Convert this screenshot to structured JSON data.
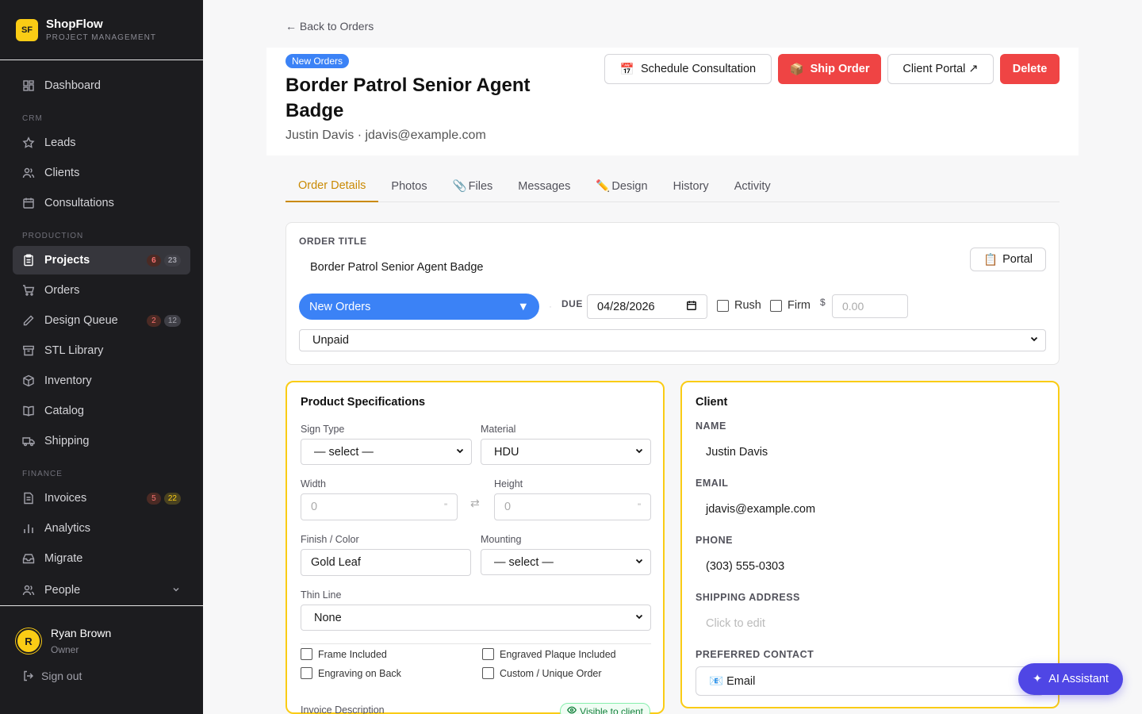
{
  "brand": {
    "logo": "SF",
    "name": "ShopFlow",
    "subtitle": "PROJECT MANAGEMENT"
  },
  "nav": {
    "dashboard": "Dashboard",
    "crm_section": "CRM",
    "leads": "Leads",
    "clients": "Clients",
    "consultations": "Consultations",
    "production_section": "PRODUCTION",
    "projects": "Projects",
    "projects_badge_red": "6",
    "projects_badge_gray": "23",
    "orders": "Orders",
    "design_queue": "Design Queue",
    "design_badge_red": "2",
    "design_badge_gray": "12",
    "stl_library": "STL Library",
    "inventory": "Inventory",
    "catalog": "Catalog",
    "shipping": "Shipping",
    "finance_section": "FINANCE",
    "invoices": "Invoices",
    "invoices_badge_red": "5",
    "invoices_badge_yellow": "22",
    "analytics": "Analytics",
    "migrate": "Migrate",
    "people": "People"
  },
  "user": {
    "initial": "R",
    "name": "Ryan Brown",
    "role": "Owner",
    "signout": "Sign out"
  },
  "back_link": "← Back to Orders",
  "header": {
    "status": "New Orders",
    "title": "Border Patrol Senior Agent Badge",
    "subtitle": "Justin Davis · jdavis@example.com",
    "btn_schedule": "Schedule Consultation",
    "btn_ship": "Ship Order",
    "btn_portal": "Client Portal ↗",
    "btn_delete": "Delete"
  },
  "tabs": [
    "Order Details",
    "Photos",
    "Files",
    "Messages",
    "Design",
    "History",
    "Activity"
  ],
  "order": {
    "title_label": "ORDER TITLE",
    "title_value": "Border Patrol Senior Agent Badge",
    "portal_btn": "Portal",
    "status": "New Orders",
    "due_label": "DUE",
    "due_date": "04/28/2026",
    "rush": "Rush",
    "firm": "Firm",
    "currency": "$",
    "price_placeholder": "0.00",
    "payment": "Unpaid"
  },
  "specs": {
    "title": "Product Specifications",
    "sign_type_label": "Sign Type",
    "sign_type": "— select —",
    "material_label": "Material",
    "material": "HDU",
    "width_label": "Width",
    "width_placeholder": "0",
    "height_label": "Height",
    "height_placeholder": "0",
    "unit": "\"",
    "finish_label": "Finish / Color",
    "finish": "Gold Leaf",
    "mounting_label": "Mounting",
    "mounting": "— select —",
    "thin_line_label": "Thin Line",
    "thin_line": "None",
    "frame_included": "Frame Included",
    "engraved_plaque": "Engraved Plaque Included",
    "engraving_back": "Engraving on Back",
    "custom_order": "Custom / Unique Order",
    "invoice_desc_label": "Invoice Description",
    "visible_badge": "Visible to client"
  },
  "client": {
    "title": "Client",
    "name_label": "NAME",
    "name": "Justin Davis",
    "email_label": "EMAIL",
    "email": "jdavis@example.com",
    "phone_label": "PHONE",
    "phone": "(303) 555-0303",
    "address_label": "SHIPPING ADDRESS",
    "address_placeholder": "Click to edit",
    "contact_label": "PREFERRED CONTACT",
    "contact": "Email"
  },
  "ai_button": "AI Assistant",
  "colors": {
    "accent_yellow": "#facc15",
    "primary_blue": "#3b82f6",
    "danger_red": "#ef4444",
    "ai_indigo": "#4f46e5"
  }
}
